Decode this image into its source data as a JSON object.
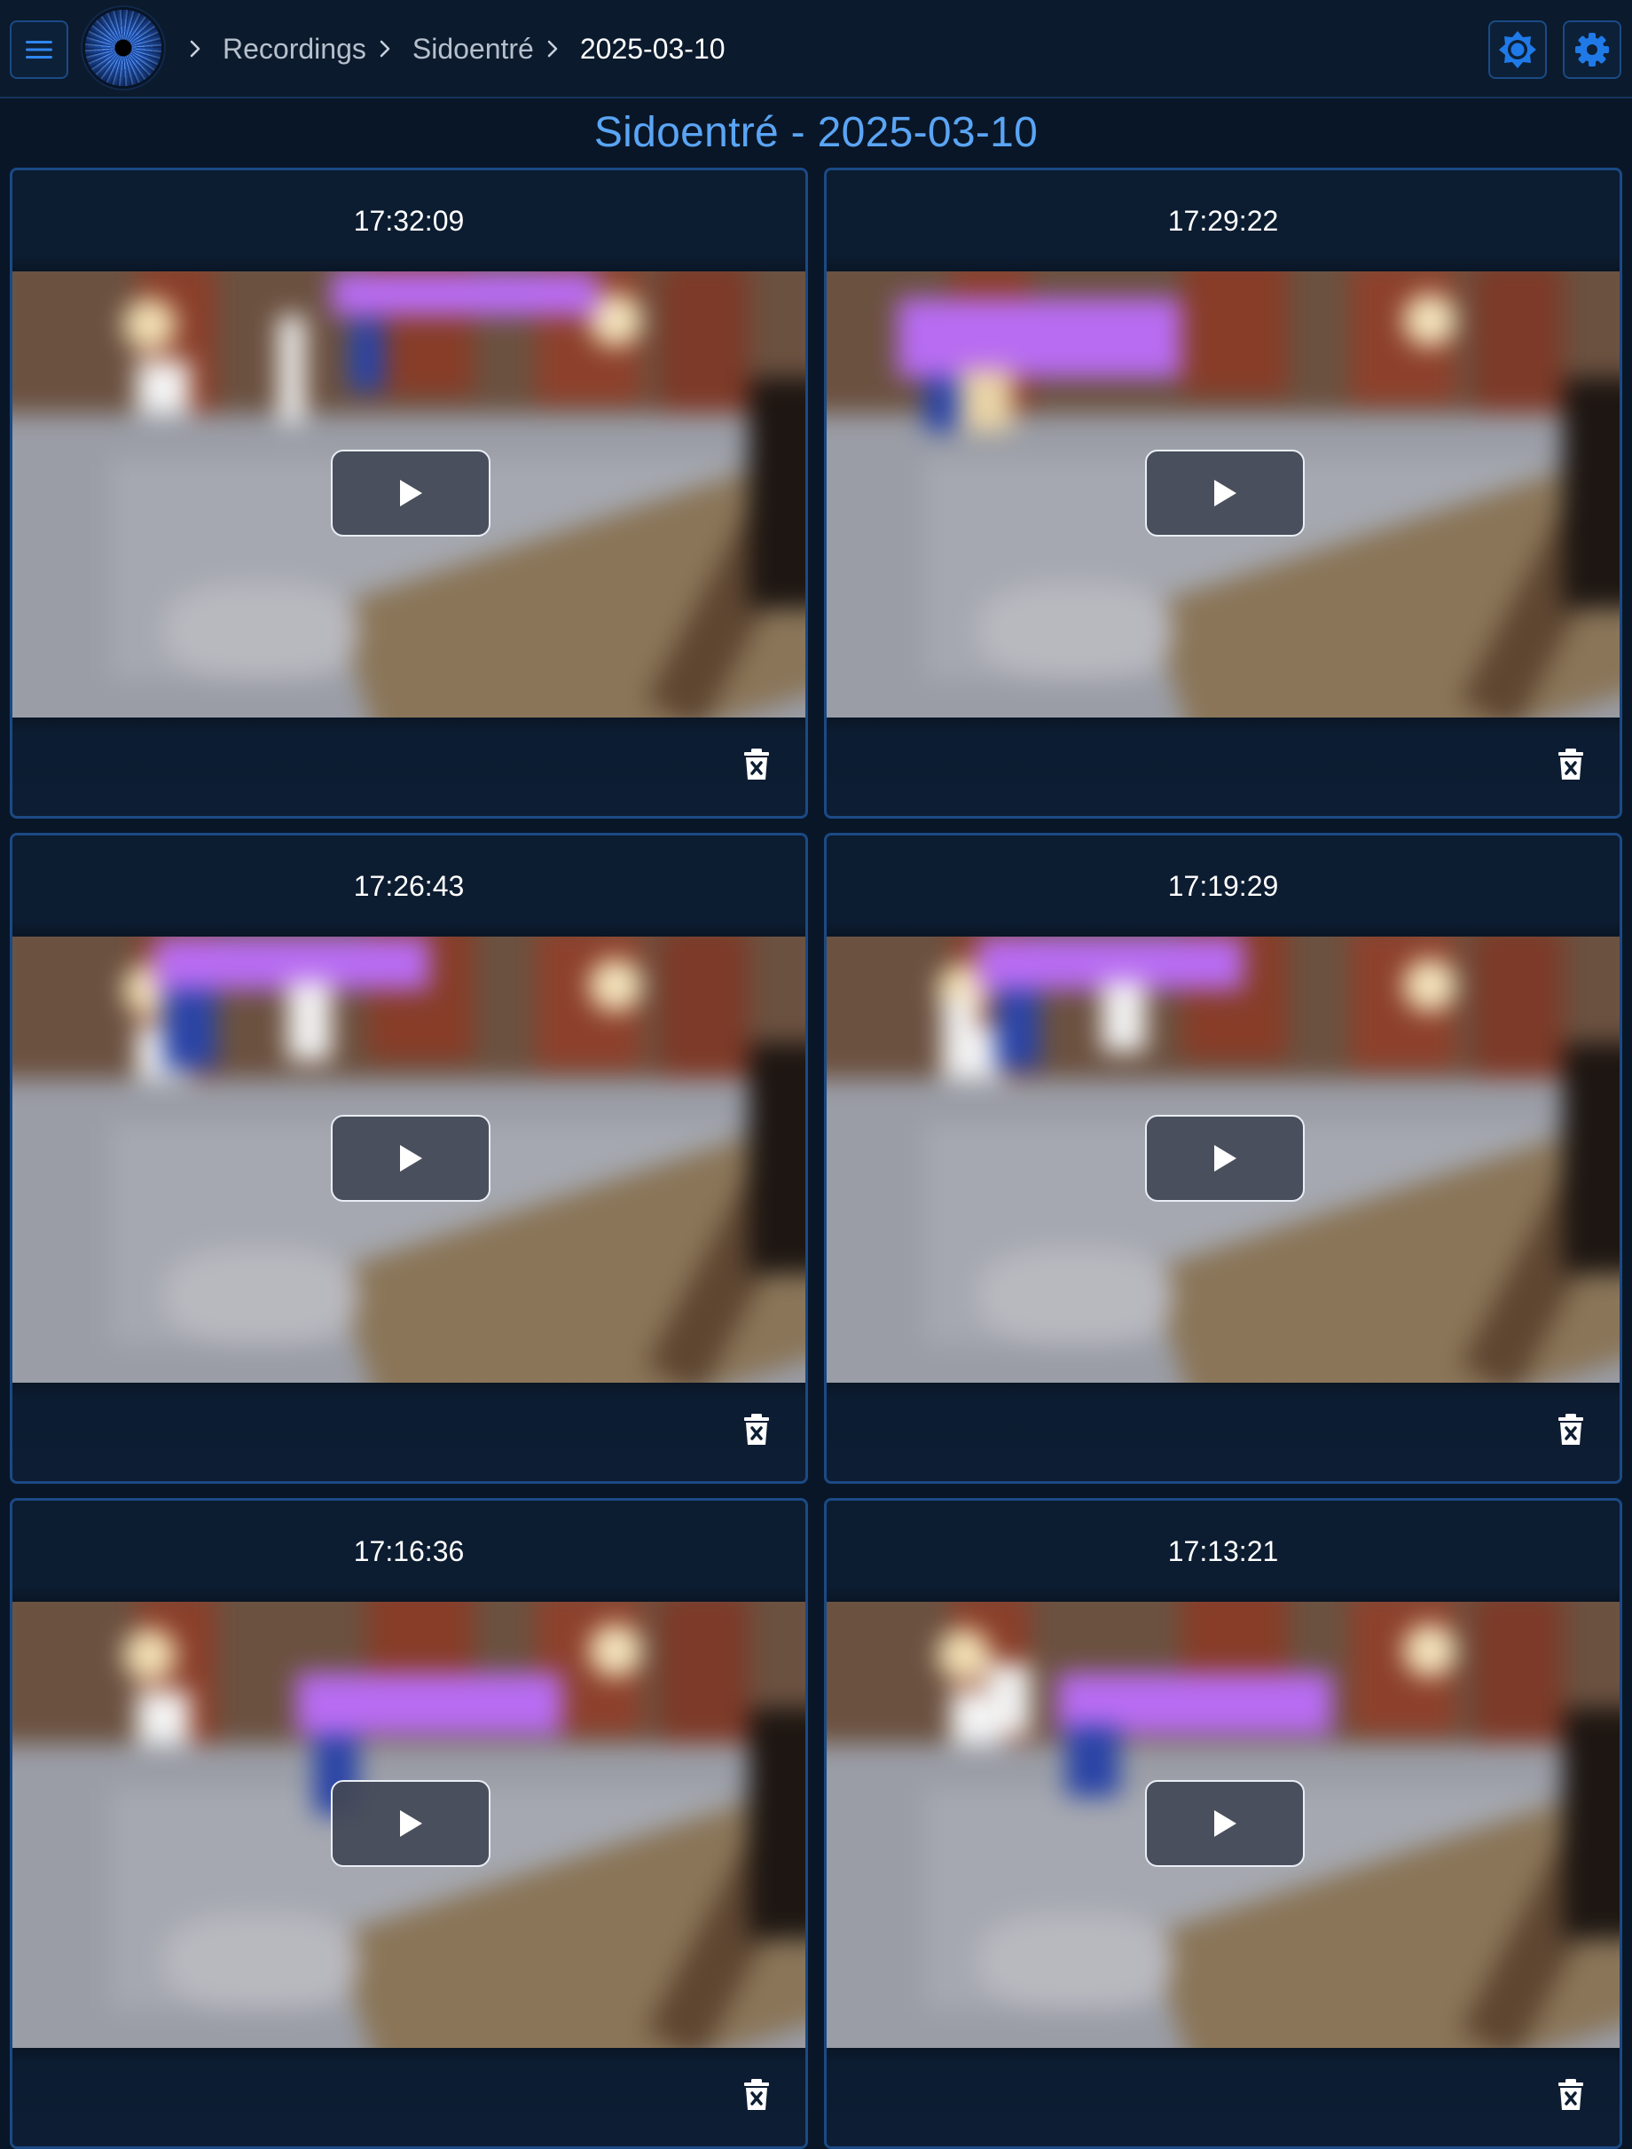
{
  "topbar": {
    "breadcrumb": {
      "items": [
        "Recordings",
        "Sidoentré"
      ],
      "current": "2025-03-10"
    },
    "icons": {
      "menu": "menu-icon",
      "logo": "eye-iris-logo",
      "theme": "brightness-icon",
      "settings": "gear-icon"
    }
  },
  "page": {
    "title": "Sidoentré - 2025-03-10"
  },
  "recordings": [
    {
      "time": "17:32:09"
    },
    {
      "time": "17:29:22"
    },
    {
      "time": "17:26:43"
    },
    {
      "time": "17:19:29"
    },
    {
      "time": "17:16:36"
    },
    {
      "time": "17:13:21"
    }
  ],
  "colors": {
    "background": "#091627",
    "accent": "#5aa5f5",
    "border": "#1b4a85",
    "icon_blue": "#1f7ae8"
  }
}
